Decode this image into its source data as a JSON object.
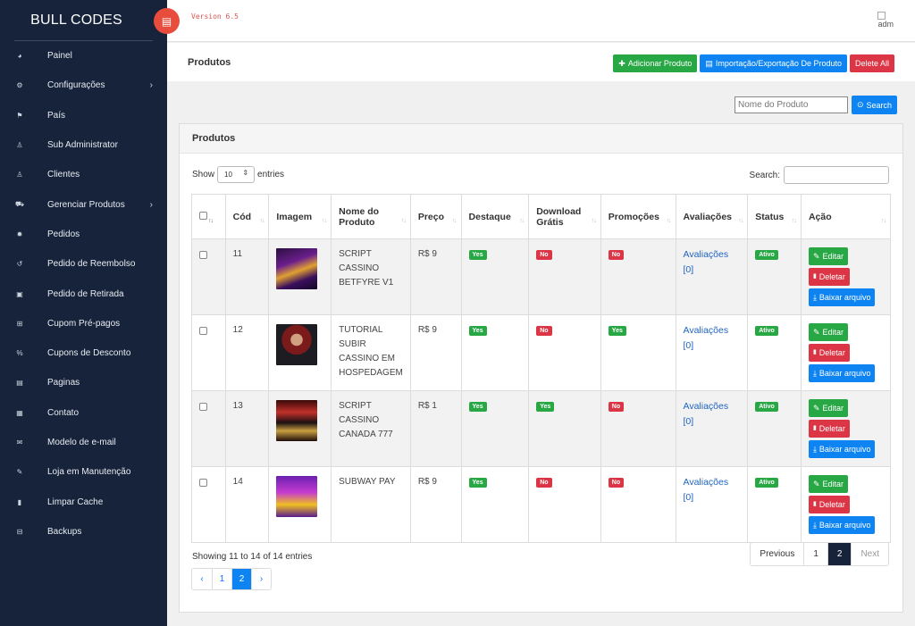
{
  "sidebar": {
    "brand": "BULL CODES",
    "items": [
      {
        "label": "Painel",
        "icon": "tachometer-icon",
        "glyph": "◕",
        "chevron": false
      },
      {
        "label": "Configurações",
        "icon": "cogs-icon",
        "glyph": "⚙",
        "chevron": true
      },
      {
        "label": "País",
        "icon": "flag-icon",
        "glyph": "⚑",
        "chevron": false
      },
      {
        "label": "Sub Administrator",
        "icon": "user-icon",
        "glyph": "♙",
        "chevron": false
      },
      {
        "label": "Clientes",
        "icon": "user-icon",
        "glyph": "♙",
        "chevron": false
      },
      {
        "label": "Gerenciar Produtos",
        "icon": "cart-icon",
        "glyph": "⛟",
        "chevron": true
      },
      {
        "label": "Pedidos",
        "icon": "order-icon",
        "glyph": "✹",
        "chevron": false
      },
      {
        "label": "Pedido de Reembolso",
        "icon": "undo-icon",
        "glyph": "↺",
        "chevron": false
      },
      {
        "label": "Pedido de Retirada",
        "icon": "money-icon",
        "glyph": "▣",
        "chevron": false
      },
      {
        "label": "Cupom Pré-pagos",
        "icon": "gift-icon",
        "glyph": "⊞",
        "chevron": false
      },
      {
        "label": "Cupons de Desconto",
        "icon": "percent-icon",
        "glyph": "%",
        "chevron": false
      },
      {
        "label": "Paginas",
        "icon": "file-icon",
        "glyph": "▤",
        "chevron": false
      },
      {
        "label": "Contato",
        "icon": "contact-icon",
        "glyph": "▦",
        "chevron": false
      },
      {
        "label": "Modelo de e-mail",
        "icon": "envelope-icon",
        "glyph": "✉",
        "chevron": false
      },
      {
        "label": "Loja em Manutenção",
        "icon": "wrench-icon",
        "glyph": "✎",
        "chevron": false
      },
      {
        "label": "Limpar Cache",
        "icon": "trash-icon",
        "glyph": "▮",
        "chevron": false
      },
      {
        "label": "Backups",
        "icon": "database-icon",
        "glyph": "⊟",
        "chevron": false
      }
    ]
  },
  "topbar": {
    "version": "Version 6.5",
    "user_alt": "adm"
  },
  "page": {
    "title": "Produtos",
    "add_button": "Adicionar Produto",
    "import_button": "Importação/Exportação De Produto",
    "delete_all_button": "Delete All"
  },
  "search": {
    "placeholder": "Nome do Produto",
    "button": "Search"
  },
  "card": {
    "title": "Produtos",
    "show_label": "Show",
    "entries_label": "entries",
    "page_length": "10",
    "search_label": "Search:"
  },
  "table": {
    "columns": [
      "",
      "Cód",
      "Imagem",
      "Nome do Produto",
      "Preço",
      "Destaque",
      "Download Grátis",
      "Promoções",
      "Avaliações",
      "Status",
      "Ação"
    ],
    "rows": [
      {
        "code": "11",
        "name": "SCRIPT CASSINO BETFYRE V1",
        "price": "R$ 9",
        "destaque": "Yes",
        "download": "No",
        "promo": "No",
        "reviews": "Avaliações [0]",
        "status": "Ativo",
        "img": "img-1"
      },
      {
        "code": "12",
        "name": "TUTORIAL SUBIR CASSINO EM HOSPEDAGEM",
        "price": "R$ 9",
        "destaque": "Yes",
        "download": "No",
        "promo": "Yes",
        "reviews": "Avaliações [0]",
        "status": "Ativo",
        "img": "img-2"
      },
      {
        "code": "13",
        "name": "SCRIPT CASSINO CANADA 777",
        "price": "R$ 1",
        "destaque": "Yes",
        "download": "Yes",
        "promo": "No",
        "reviews": "Avaliações [0]",
        "status": "Ativo",
        "img": "img-3"
      },
      {
        "code": "14",
        "name": "SUBWAY PAY",
        "price": "R$ 9",
        "destaque": "Yes",
        "download": "No",
        "promo": "No",
        "reviews": "Avaliações [0]",
        "status": "Ativo",
        "img": "img-4"
      }
    ],
    "actions": {
      "edit": "Editar",
      "delete": "Deletar",
      "download": "Baixar arquivo"
    }
  },
  "footer": {
    "info": "Showing 11 to 14 of 14 entries",
    "pager": {
      "previous": "Previous",
      "p1": "1",
      "p2": "2",
      "next": "Next"
    },
    "pager2": {
      "prev": "‹",
      "p1": "1",
      "p2": "2",
      "next": "›"
    }
  },
  "colors": {
    "sidebar_bg": "#16233a",
    "accent_green": "#28a745",
    "accent_blue": "#0d84f1",
    "accent_red": "#dc3545"
  }
}
